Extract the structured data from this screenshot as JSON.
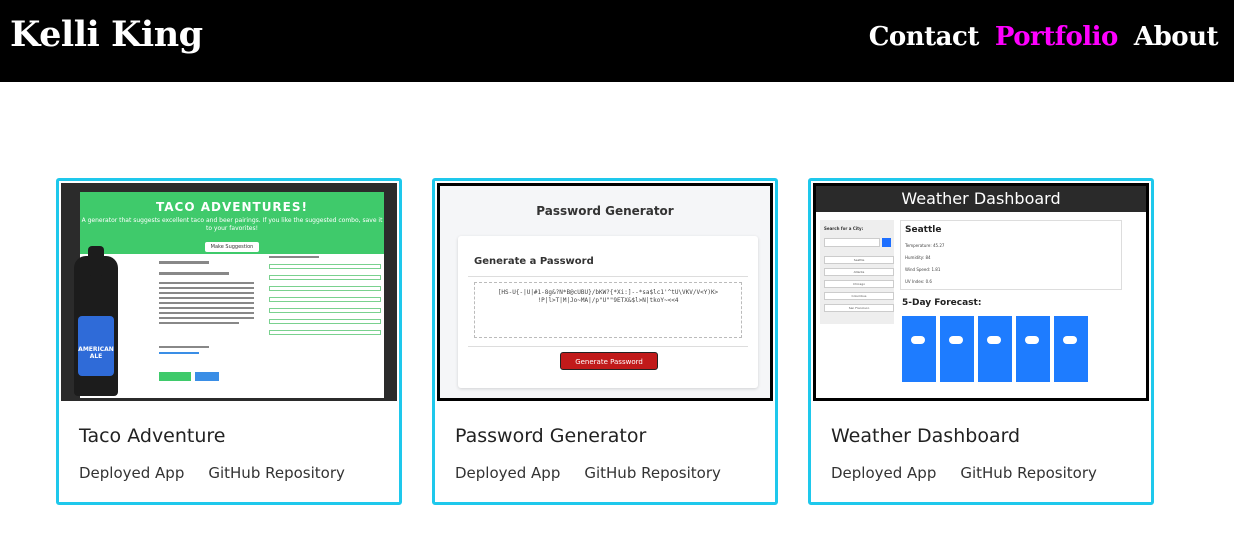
{
  "header": {
    "brand": "Kelli King",
    "nav": [
      "Contact",
      "Portfolio",
      "About"
    ],
    "active_index": 1,
    "accent": "#ff00ff"
  },
  "cards": [
    {
      "title": "Taco Adventure",
      "links": [
        "Deployed App",
        "GitHub Repository"
      ],
      "thumb": {
        "heading": "TACO ADVENTURES!",
        "subtitle": "A generator that suggests excellent taco and beer pairings. If you like the suggested combo, save it to your favorites!",
        "button": "Make Suggestion",
        "bottle_label": "AMERICAN ALE"
      }
    },
    {
      "title": "Password Generator",
      "links": [
        "Deployed App",
        "GitHub Repository"
      ],
      "thumb": {
        "heading": "Password Generator",
        "subheading": "Generate a Password",
        "password": "[HS-U{-|U|#1-8g&?N*B@cUBU}/bKW?{*Xi:]--*sa$lc1'^tU\\VKV/V<Y)K> !P|l>T|M|Jo~MA|/p\"U\"\"9ETX&$l>N|tkoY~<<4",
        "button": "Generate Password"
      }
    },
    {
      "title": "Weather Dashboard",
      "links": [
        "Deployed App",
        "GitHub Repository"
      ],
      "thumb": {
        "heading": "Weather Dashboard",
        "search_label": "Search for a City:",
        "cities": [
          "Seattle",
          "Atlanta",
          "Chicago",
          "Columbus",
          "San Francisco"
        ],
        "current_city": "Seattle",
        "stats": [
          "Temperature: 45.27",
          "Humidity: 84",
          "Wind Speed: 1.81",
          "UV Index: 0.6"
        ],
        "forecast_label": "5-Day Forecast:"
      }
    }
  ],
  "colors": {
    "card_border": "#1ec8ec",
    "taco_green": "#3fca6b",
    "pw_red": "#c11a1a",
    "wx_blue": "#1e7cff"
  }
}
